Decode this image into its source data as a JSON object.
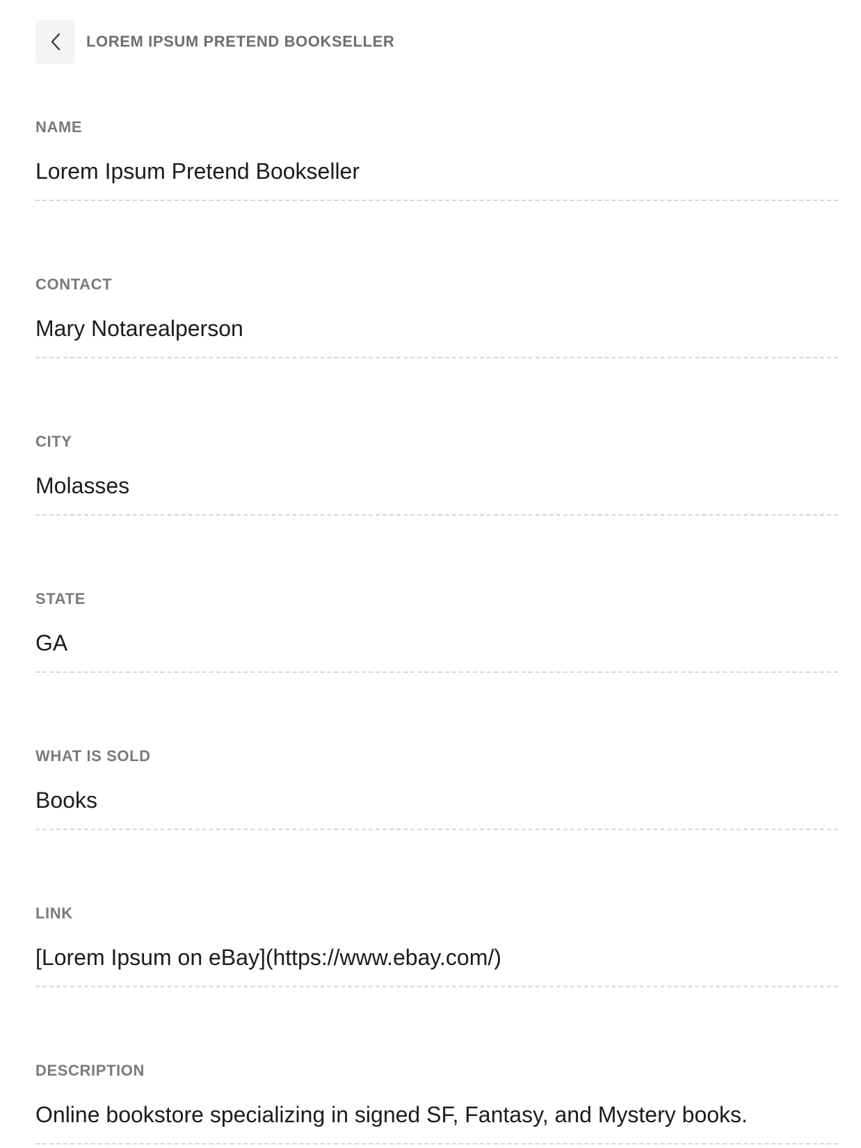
{
  "header": {
    "title": "LOREM IPSUM PRETEND BOOKSELLER",
    "back_icon": "chevron-left-icon"
  },
  "fields": [
    {
      "key": "name",
      "label": "NAME",
      "value": "Lorem Ipsum Pretend Bookseller"
    },
    {
      "key": "contact",
      "label": "CONTACT",
      "value": "Mary Notarealperson"
    },
    {
      "key": "city",
      "label": "CITY",
      "value": "Molasses"
    },
    {
      "key": "state",
      "label": "STATE",
      "value": "GA"
    },
    {
      "key": "what-is-sold",
      "label": "WHAT IS SOLD",
      "value": "Books"
    },
    {
      "key": "link",
      "label": "LINK",
      "value": "[Lorem Ipsum on eBay](https://www.ebay.com/)"
    },
    {
      "key": "description",
      "label": "DESCRIPTION",
      "value": "Online bookstore specializing in signed SF, Fantasy, and Mystery books."
    }
  ]
}
